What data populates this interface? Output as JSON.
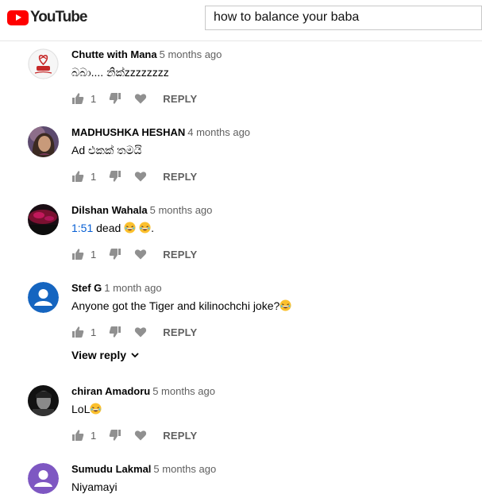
{
  "header": {
    "logo_text": "YouTube",
    "search_value": "how to balance your baba"
  },
  "comments": [
    {
      "author": "Chutte with Mana",
      "time": "5 months ago",
      "text": "බබා.... නික්zzzzzzzz",
      "likes": "1",
      "reply_label": "REPLY"
    },
    {
      "author": "MADHUSHKA HESHAN",
      "time": "4 months ago",
      "text": "Ad එකක් තමයි",
      "likes": "1",
      "reply_label": "REPLY"
    },
    {
      "author": "Dilshan Wahala",
      "time": "5 months ago",
      "timestamp_link": "1:51",
      "text": " dead ",
      "text_end": ".",
      "likes": "1",
      "reply_label": "REPLY"
    },
    {
      "author": "Stef G",
      "time": "1 month ago",
      "text": "Anyone got the Tiger and kilinochchi joke?",
      "likes": "1",
      "reply_label": "REPLY",
      "view_reply": "View reply"
    },
    {
      "author": "chiran Amadoru",
      "time": "5 months ago",
      "text": "LoL",
      "likes": "1",
      "reply_label": "REPLY"
    },
    {
      "author": "Sumudu Lakmal",
      "time": "5 months ago",
      "text": "Niyamayi"
    }
  ],
  "icons": [
    "like-icon",
    "dislike-icon",
    "heart-icon",
    "chevron-down-icon",
    "laughing-emoji-icon"
  ],
  "colors": {
    "brand": "#ff0000",
    "link": "#065fd4",
    "meta": "#606060"
  }
}
